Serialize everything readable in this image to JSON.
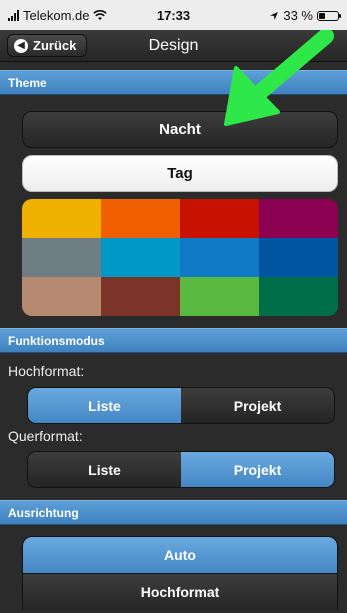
{
  "status_bar": {
    "carrier": "Telekom.de",
    "time": "17:33",
    "battery_text": "33 %",
    "battery_level": 0.33
  },
  "navbar": {
    "back_label": "Zurück",
    "title": "Design"
  },
  "theme": {
    "header": "Theme",
    "night_label": "Nacht",
    "day_label": "Tag",
    "swatch_colors": [
      "#f0b000",
      "#f06000",
      "#c81200",
      "#8b0050",
      "#6e7e83",
      "#0098c6",
      "#1079c6",
      "#0055a0",
      "#b58870",
      "#7a3528",
      "#58b840",
      "#006e48"
    ]
  },
  "mode": {
    "header": "Funktionsmodus",
    "portrait_label": "Hochformat:",
    "landscape_label": "Querformat:",
    "portrait_options": [
      "Liste",
      "Projekt"
    ],
    "portrait_selected": "Liste",
    "landscape_options": [
      "Liste",
      "Projekt"
    ],
    "landscape_selected": "Projekt"
  },
  "orientation": {
    "header": "Ausrichtung",
    "auto_label": "Auto",
    "portrait_label": "Hochformat"
  },
  "colors": {
    "accent": "#4a8fcf",
    "arrow": "#2ee84a",
    "background": "#2b2b2b"
  }
}
